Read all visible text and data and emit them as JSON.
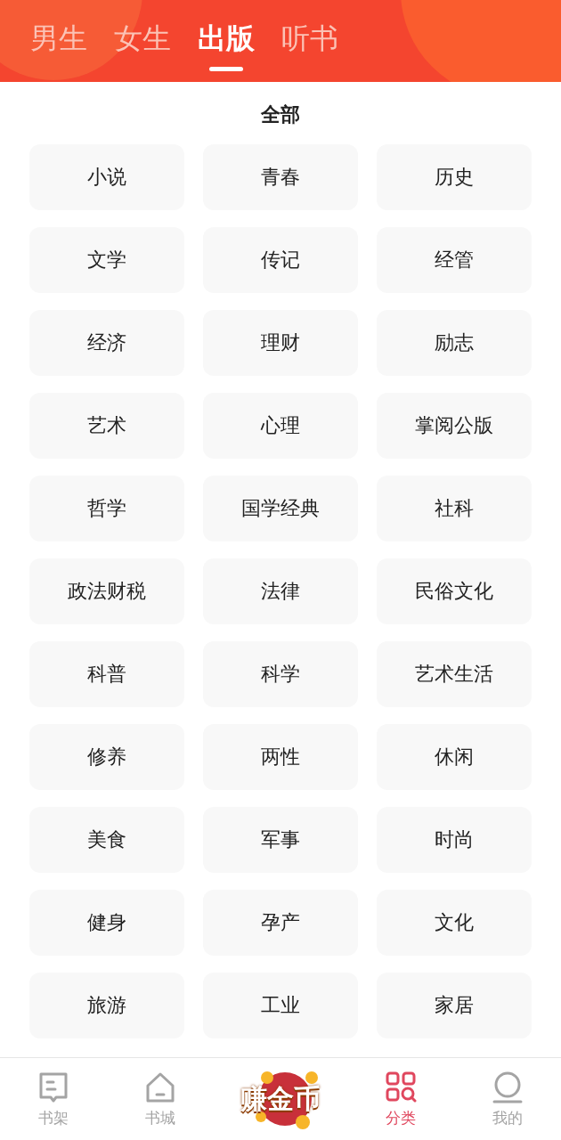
{
  "tabs": [
    {
      "label": "男生",
      "selected": false
    },
    {
      "label": "女生",
      "selected": false
    },
    {
      "label": "出版",
      "selected": true
    },
    {
      "label": "听书",
      "selected": false
    }
  ],
  "section_title": "全部",
  "categories": [
    "小说",
    "青春",
    "历史",
    "文学",
    "传记",
    "经管",
    "经济",
    "理财",
    "励志",
    "艺术",
    "心理",
    "掌阅公版",
    "哲学",
    "国学经典",
    "社科",
    "政法财税",
    "法律",
    "民俗文化",
    "科普",
    "科学",
    "艺术生活",
    "修养",
    "两性",
    "休闲",
    "美食",
    "军事",
    "时尚",
    "健身",
    "孕产",
    "文化",
    "旅游",
    "工业",
    "家居"
  ],
  "bottom_nav": [
    {
      "kind": "shelf",
      "label": "书架",
      "selected": false
    },
    {
      "kind": "store",
      "label": "书城",
      "selected": false
    },
    {
      "kind": "coin",
      "label": "赚金币",
      "selected": false
    },
    {
      "kind": "category",
      "label": "分类",
      "selected": true
    },
    {
      "kind": "profile",
      "label": "我的",
      "selected": false
    }
  ]
}
